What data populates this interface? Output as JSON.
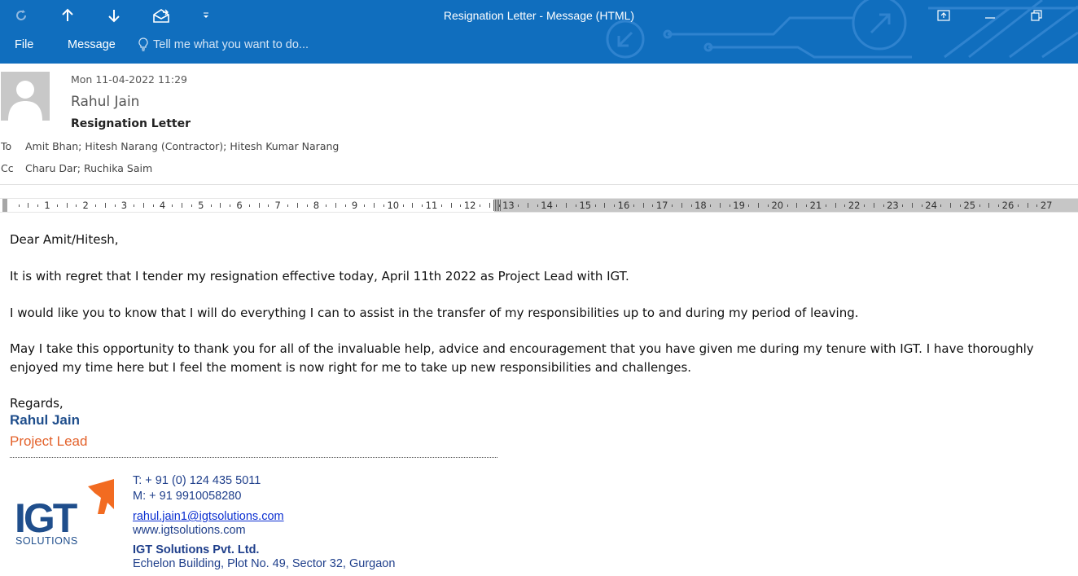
{
  "window": {
    "title": "Resignation Letter - Message (HTML)",
    "accent": "#106ebe"
  },
  "quick_access": {
    "items": [
      "refresh-icon",
      "up-arrow-icon",
      "down-arrow-icon",
      "envelope-icon",
      "customize-icon"
    ]
  },
  "ribbon": {
    "tabs": [
      "File",
      "Message"
    ],
    "tell_me": "Tell me what you want to do..."
  },
  "header": {
    "date": "Mon 11-04-2022 11:29",
    "sender": "Rahul Jain",
    "subject": "Resignation Letter",
    "to_label": "To",
    "to": "Amit Bhan; Hitesh Narang (Contractor); Hitesh Kumar Narang",
    "cc_label": "Cc",
    "cc": "Charu Dar; Ruchika Saim"
  },
  "ruler": {
    "labels": [
      "1",
      "2",
      "3",
      "4",
      "5",
      "6",
      "7",
      "8",
      "9",
      "10",
      "11",
      "12",
      "13",
      "14",
      "15",
      "16",
      "17",
      "18",
      "19",
      "20",
      "21",
      "22",
      "23",
      "24",
      "25",
      "26",
      "27"
    ]
  },
  "body": {
    "greeting": "Dear Amit/Hitesh,",
    "p1": "It is with regret that I tender my resignation effective today, April 11th 2022 as Project Lead with IGT.",
    "p2": "I would like you to know that I will do everything I can to assist in the transfer of my responsibilities up to and during my period of leaving.",
    "p3": "May I take this opportunity to thank you for all of the invaluable help, advice and encouragement that you have given me during my tenure with IGT. I have thoroughly enjoyed my time here but I feel the moment is now right for me to take up new responsibilities and challenges.",
    "closing": "Regards,"
  },
  "signature": {
    "name": "Rahul Jain",
    "title": "Project Lead",
    "phone": "T: + 91 (0) 124 435 5011",
    "mobile": "M: + 91 9910058280",
    "email": "rahul.jain1@igtsolutions.com",
    "website": "www.igtsolutions.com",
    "company": "IGT Solutions Pvt. Ltd.",
    "address": "Echelon Building, Plot No. 49, Sector 32, Gurgaon",
    "logo_text": "IGT",
    "logo_sub": "SOLUTIONS",
    "name_color": "#1f4e8c",
    "title_color": "#e3612a",
    "logo_orange": "#f26b21"
  }
}
